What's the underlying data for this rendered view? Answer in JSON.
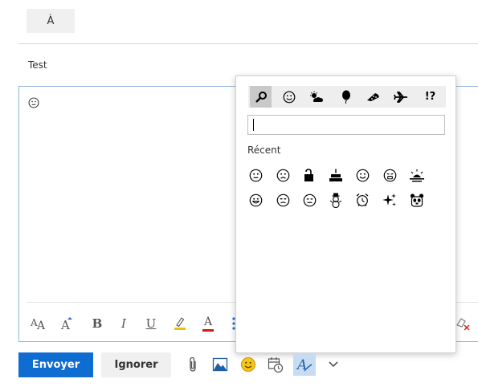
{
  "compose": {
    "to_label": "À",
    "subject": "Test",
    "body_emoji": "neutral-face"
  },
  "format_toolbar": {
    "items": [
      "font-size-icon",
      "grow-font-icon",
      "bold-icon",
      "italic-icon",
      "underline-icon",
      "highlight-icon",
      "font-color-icon",
      "bullets-icon",
      "clear-formatting-icon"
    ],
    "bold_label": "B",
    "italic_label": "I",
    "underline_label": "U",
    "font_color_label": "A",
    "highlight_color": "#e8c300",
    "font_color": "#d41717"
  },
  "actions": {
    "send_label": "Envoyer",
    "ignore_label": "Ignorer",
    "send_color": "#0f6cd1",
    "icons": [
      "attach-icon",
      "insert-picture-icon",
      "emoji-icon",
      "schedule-icon",
      "format-options-icon",
      "more-options-icon"
    ]
  },
  "emoji_picker": {
    "categories": [
      "search",
      "smileys",
      "weather",
      "celebration",
      "food",
      "travel",
      "symbols"
    ],
    "selected_category": "search",
    "symbols_label": "!?",
    "search_value": "",
    "recent_label": "Récent",
    "recent": [
      "neutral-face",
      "sad-face",
      "open-lock",
      "birthday-cake",
      "smiling-face",
      "crying-face",
      "sunrise",
      "grinning-face",
      "annoyed-face",
      "expressionless-face",
      "snowman",
      "alarm-clock",
      "sparkles",
      "panda"
    ]
  }
}
